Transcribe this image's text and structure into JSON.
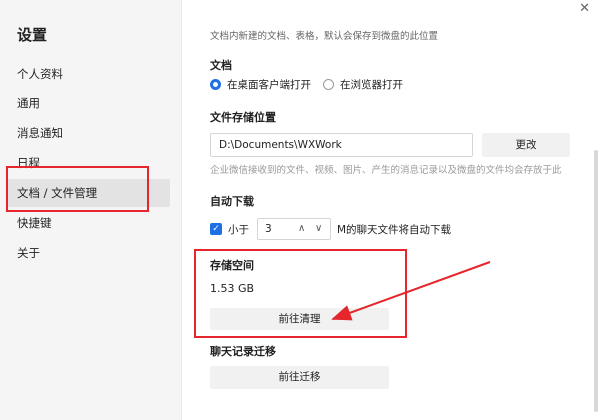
{
  "sidebar": {
    "title": "设置",
    "items": [
      {
        "label": "个人资料"
      },
      {
        "label": "通用"
      },
      {
        "label": "消息通知"
      },
      {
        "label": "日程"
      },
      {
        "label": "文档 / 文件管理"
      },
      {
        "label": "快捷键"
      },
      {
        "label": "关于"
      }
    ]
  },
  "main": {
    "description": "文档内新建的文档、表格，默认会保存到微盘的此位置",
    "document": {
      "title": "文档",
      "option_desktop": "在桌面客户端打开",
      "option_browser": "在浏览器打开"
    },
    "storage_location": {
      "title": "文件存储位置",
      "path": "D:\\Documents\\WXWork",
      "change_label": "更改",
      "hint": "企业微信接收到的文件、视频、图片、产生的消息记录以及微盘的文件均会存放于此"
    },
    "auto_download": {
      "title": "自动下载",
      "prefix": "小于",
      "value": "3",
      "suffix": "M的聊天文件将自动下载"
    },
    "storage_space": {
      "title": "存储空间",
      "size": "1.53 GB",
      "clean_label": "前往清理"
    },
    "chat_migration": {
      "title": "聊天记录迁移",
      "migrate_label": "前往迁移"
    }
  },
  "colors": {
    "accent": "#1f6fe5",
    "annotation": "#e5262c"
  }
}
